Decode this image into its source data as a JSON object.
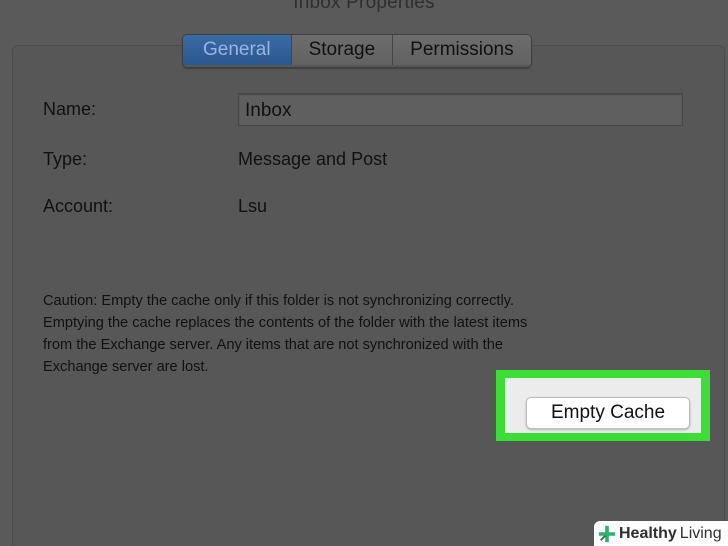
{
  "window": {
    "title": "Inbox Properties"
  },
  "tabs": [
    {
      "label": "General",
      "active": true
    },
    {
      "label": "Storage",
      "active": false
    },
    {
      "label": "Permissions",
      "active": false
    }
  ],
  "fields": {
    "name_label": "Name:",
    "name_value": "Inbox",
    "type_label": "Type:",
    "type_value": "Message and Post",
    "account_label": "Account:",
    "account_value": "Lsu"
  },
  "caution": {
    "line1": "Caution: Empty the cache only if this folder is not synchronizing correctly.",
    "line2": "Emptying the cache replaces the contents of the folder with the latest items",
    "line3": "from the Exchange server. Any items that are not synchronized with the",
    "line4": "Exchange server are lost."
  },
  "actions": {
    "empty_cache_label": "Empty Cache"
  },
  "watermark": {
    "brand": "Healthy",
    "sub": "Living"
  },
  "colors": {
    "highlight": "#3bde34",
    "active_tab": "#2f5e9a",
    "logo": "#2eb06b"
  },
  "icons": {
    "watermark_logo": "plus-cross-logo-icon"
  }
}
